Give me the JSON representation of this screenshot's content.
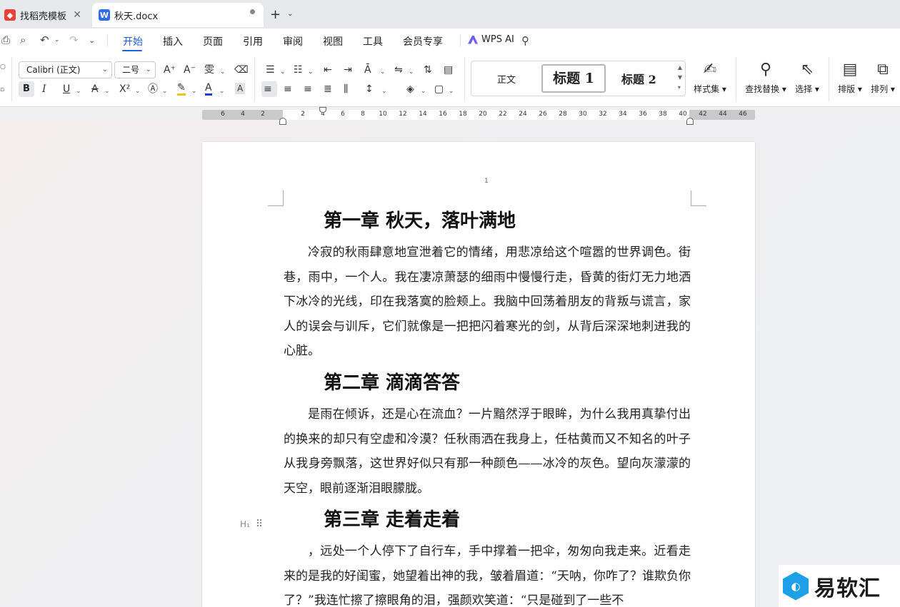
{
  "tabs": [
    {
      "title": "找稻壳模板",
      "close": "✕"
    },
    {
      "title": "秋天.docx"
    }
  ],
  "menubar": {
    "items": [
      "开始",
      "插入",
      "页面",
      "引用",
      "审阅",
      "视图",
      "工具",
      "会员专享"
    ],
    "wps_ai": "WPS AI"
  },
  "ribbon": {
    "font_name": "Calibri (正文)",
    "font_size": "二号",
    "styles": {
      "normal": "正文",
      "heading1": "标题 1",
      "heading2": "标题 2"
    },
    "style_set": "样式集",
    "find_replace": "查找替换",
    "select": "选择",
    "layout": "排版",
    "arrange": "排列"
  },
  "ruler": {
    "left_numbers": [
      "6",
      "4",
      "2"
    ],
    "right_numbers": [
      "2",
      "4",
      "6",
      "8",
      "10",
      "12",
      "14",
      "16",
      "18",
      "20",
      "22",
      "24",
      "26",
      "28",
      "30",
      "32",
      "34",
      "36",
      "38",
      "40",
      "42",
      "44",
      "46"
    ]
  },
  "document": {
    "page_number": "1",
    "sections": [
      {
        "heading": "第一章  秋天，落叶满地",
        "paragraph": "冷寂的秋雨肆意地宣泄着它的情绪，用悲凉给这个喧嚣的世界调色。街巷，雨中，一个人。我在凄凉萧瑟的细雨中慢慢行走，昏黄的街灯无力地洒下冰冷的光线，印在我落寞的脸颊上。我脑中回荡着朋友的背叛与谎言，家人的误会与训斥，它们就像是一把把闪着寒光的剑，从背后深深地刺进我的心脏。"
      },
      {
        "heading": "第二章  滴滴答答",
        "paragraph": "是雨在倾诉，还是心在流血？一片黯然浮于眼眸，为什么我用真挚付出的换来的却只有空虚和冷漠？任秋雨洒在我身上，任枯黄而又不知名的叶子从我身旁飘落，这世界好似只有那一种颜色——冰冷的灰色。望向灰濛濛的天空，眼前逐渐泪眼朦胧。"
      },
      {
        "heading": "第三章  走着走着",
        "paragraph": "，远处一个人停下了自行车，手中撑着一把伞，匆匆向我走来。近看走来的是我的好闺蜜，她望着出神的我，皱着眉道：“天呐，你咋了？谁欺负你了？”我连忙擦了擦眼角的泪，强颜欢笑道：“只是碰到了一些不"
      }
    ],
    "block_handle": "H₁"
  },
  "watermark": {
    "text": "易软汇"
  }
}
